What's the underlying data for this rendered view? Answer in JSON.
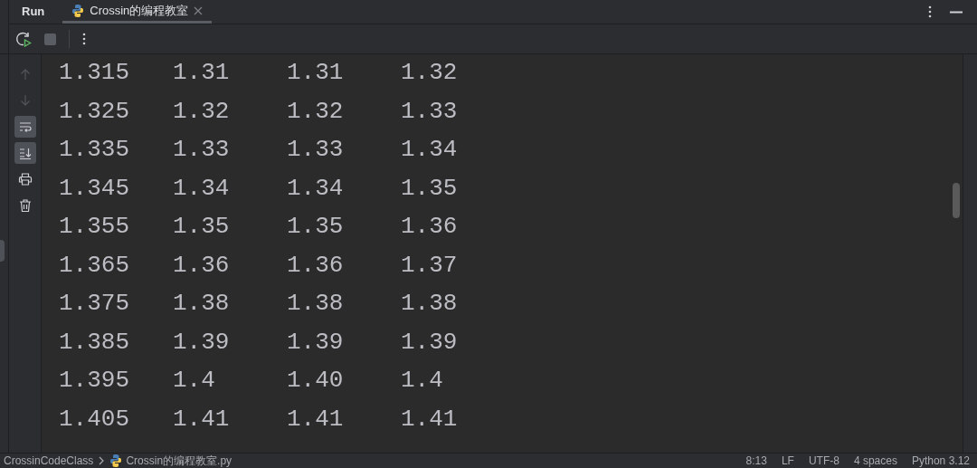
{
  "tool_window": {
    "title": "Run"
  },
  "tabs": [
    {
      "label": "Crossin的编程教室",
      "selected": true
    }
  ],
  "side_tools": [
    {
      "kind": "up",
      "disabled": true
    },
    {
      "kind": "down",
      "disabled": true
    },
    {
      "kind": "wrap",
      "on": true
    },
    {
      "kind": "scroll-end",
      "on": true
    },
    {
      "kind": "print",
      "disabled": false
    },
    {
      "kind": "trash",
      "disabled": false
    }
  ],
  "console": {
    "rows": [
      [
        "1.315",
        "1.31",
        "1.31",
        "1.32"
      ],
      [
        "1.325",
        "1.32",
        "1.32",
        "1.33"
      ],
      [
        "1.335",
        "1.33",
        "1.33",
        "1.34"
      ],
      [
        "1.345",
        "1.34",
        "1.34",
        "1.35"
      ],
      [
        "1.355",
        "1.35",
        "1.35",
        "1.36"
      ],
      [
        "1.365",
        "1.36",
        "1.36",
        "1.37"
      ],
      [
        "1.375",
        "1.38",
        "1.38",
        "1.38"
      ],
      [
        "1.385",
        "1.39",
        "1.39",
        "1.39"
      ],
      [
        "1.395",
        "1.4",
        "1.40",
        "1.4"
      ],
      [
        "1.405",
        "1.41",
        "1.41",
        "1.41"
      ]
    ]
  },
  "status_bar": {
    "breadcrumbs": [
      "CrossinCodeClass",
      "Crossin的编程教室.py"
    ],
    "items": [
      "8:13",
      "LF",
      "UTF-8",
      "4 spaces",
      "Python 3.12"
    ]
  }
}
